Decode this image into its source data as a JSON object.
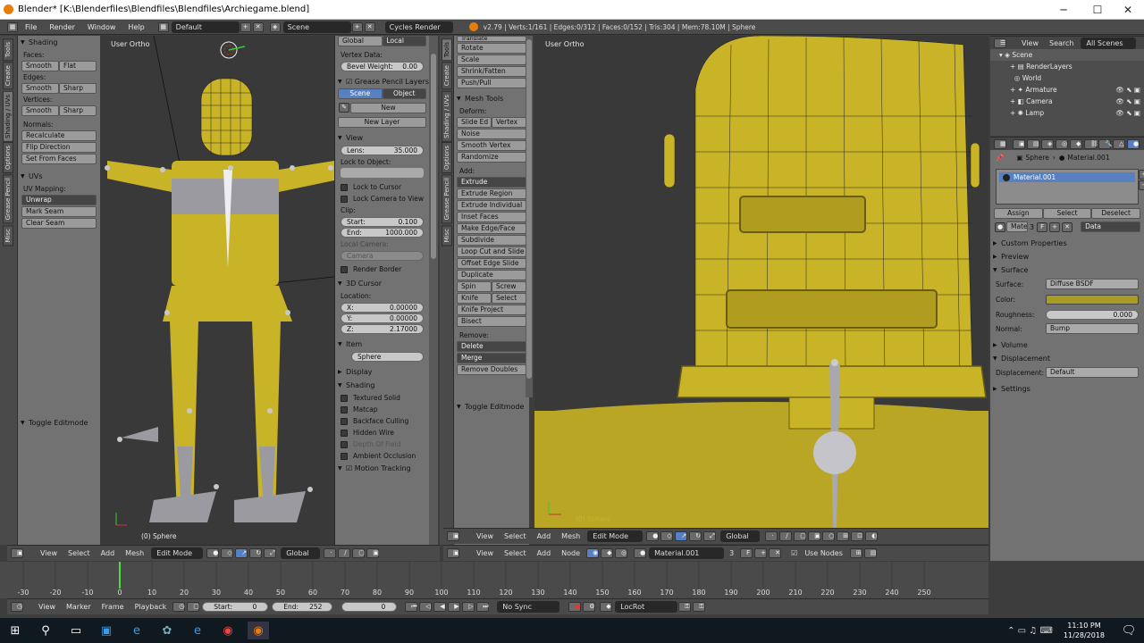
{
  "window": {
    "title": "Blender* [K:\\Blenderfiles\\Blendfiles\\Blendfiles\\Archiegame.blend]",
    "minimize": "─",
    "maximize": "☐",
    "close": "✕"
  },
  "topbar": {
    "menus": [
      "File",
      "Render",
      "Window",
      "Help"
    ],
    "layout": "Default",
    "scene": "Scene",
    "engine": "Cycles Render",
    "stats": "v2.79 | Verts:1/161 | Edges:0/312 | Faces:0/152 | Tris:304 | Mem:78.10M | Sphere"
  },
  "left_tabs": [
    "Tools",
    "Create",
    "Shading / UVs",
    "Options",
    "Grease Pencil",
    "Misc"
  ],
  "left_panel": {
    "shading_header": "Shading",
    "faces_label": "Faces:",
    "smooth": "Smooth",
    "flat": "Flat",
    "edges_label": "Edges:",
    "sharp": "Sharp",
    "vertices_label": "Vertices:",
    "normals_label": "Normals:",
    "recalculate": "Recalculate",
    "flip_direction": "Flip Direction",
    "set_from_faces": "Set From Faces",
    "uvs_header": "UVs",
    "uv_mapping_label": "UV Mapping:",
    "unwrap": "Unwrap",
    "mark_seam": "Mark Seam",
    "clear_seam": "Clear Seam",
    "toggle_editmode": "Toggle Editmode"
  },
  "vp_left": {
    "label": "User Ortho",
    "object": "(0) Sphere",
    "mode": "Edit Mode",
    "orientation": "Global",
    "menus": [
      "View",
      "Select",
      "Add",
      "Mesh"
    ]
  },
  "props_n": {
    "tab_global": "Global",
    "tab_local": "Local",
    "vertex_data": "Vertex Data:",
    "bevel_weight_label": "Bevel Weight:",
    "bevel_weight": "0.00",
    "gp_header": "Grease Pencil Layers",
    "scene": "Scene",
    "object": "Object",
    "new": "New",
    "new_layer": "New Layer",
    "view_header": "View",
    "lens_label": "Lens:",
    "lens": "35.000",
    "lock_to_object": "Lock to Object:",
    "lock_to_cursor": "Lock to Cursor",
    "lock_camera": "Lock Camera to View",
    "clip_label": "Clip:",
    "start_label": "Start:",
    "start": "0.100",
    "end_label": "End:",
    "end": "1000.000",
    "local_camera": "Local Camera:",
    "camera": "Camera",
    "render_border": "Render Border",
    "cursor_header": "3D Cursor",
    "location_label": "Location:",
    "x_label": "X:",
    "x": "0.00000",
    "y_label": "Y:",
    "y": "0.00000",
    "z_label": "Z:",
    "z": "2.17000",
    "item_header": "Item",
    "item_name": "Sphere",
    "display_header": "Display",
    "shading_header": "Shading",
    "textured_solid": "Textured Solid",
    "matcap": "Matcap",
    "backface_culling": "Backface Culling",
    "hidden_wire": "Hidden Wire",
    "depth_of_field": "Depth Of Field",
    "ambient_occlusion": "Ambient Occlusion",
    "motion_tracking": "Motion Tracking"
  },
  "mid_tabs": [
    "Tools",
    "Create",
    "Shading / UVs",
    "Options",
    "Grease Pencil",
    "Misc"
  ],
  "mesh_tools": {
    "translate": "Translate",
    "rotate": "Rotate",
    "scale": "Scale",
    "shrink_fatten": "Shrink/Fatten",
    "push_pull": "Push/Pull",
    "header": "Mesh Tools",
    "deform": "Deform:",
    "slide_edge": "Slide Ed",
    "vertex": "Vertex",
    "noise": "Noise",
    "smooth_vertex": "Smooth Vertex",
    "randomize": "Randomize",
    "add": "Add:",
    "extrude": "Extrude",
    "extrude_region": "Extrude Region",
    "extrude_individual": "Extrude Individual",
    "inset_faces": "Inset Faces",
    "make_edge_face": "Make Edge/Face",
    "subdivide": "Subdivide",
    "loop_cut": "Loop Cut and Slide",
    "offset_edge": "Offset Edge Slide",
    "duplicate": "Duplicate",
    "spin": "Spin",
    "screw": "Screw",
    "knife": "Knife",
    "select": "Select",
    "knife_project": "Knife Project",
    "bisect": "Bisect",
    "remove": "Remove:",
    "delete": "Delete",
    "merge": "Merge",
    "remove_doubles": "Remove Doubles",
    "toggle_editmode": "Toggle Editmode"
  },
  "vp_right": {
    "label": "User Ortho",
    "object": "(0) Sphere",
    "mode": "Edit Mode",
    "orientation": "Global",
    "menus": [
      "View",
      "Select",
      "Add",
      "Mesh"
    ]
  },
  "node_hdr": {
    "menus": [
      "View",
      "Select",
      "Add",
      "Node"
    ],
    "material": "Material.001",
    "users": "3",
    "use_nodes": "Use Nodes"
  },
  "left_node_hdr": {
    "menus": [
      "View",
      "Select",
      "Add",
      "Mesh"
    ],
    "mode": "Edit Mode",
    "orientation": "Global"
  },
  "outliner": {
    "menus": [
      "View",
      "Search"
    ],
    "filter": "All Scenes",
    "items": [
      "Scene",
      "RenderLayers",
      "World",
      "Armature",
      "Camera",
      "Lamp"
    ]
  },
  "properties": {
    "breadcrumb_object": "Sphere",
    "breadcrumb_material": "Material.001",
    "slot": "Material.001",
    "assign": "Assign",
    "select": "Select",
    "deselect": "Deselect",
    "mat_field": "Mater",
    "mat_users": "3",
    "f": "F",
    "data": "Data",
    "custom_props": "Custom Properties",
    "preview": "Preview",
    "surface_header": "Surface",
    "surface_label": "Surface:",
    "surface": "Diffuse BSDF",
    "color_label": "Color:",
    "roughness_label": "Roughness:",
    "roughness": "0.000",
    "normal_label": "Normal:",
    "normal": "Bump",
    "volume": "Volume",
    "displacement_header": "Displacement",
    "displacement_label": "Displacement:",
    "displacement": "Default",
    "settings": "Settings"
  },
  "timeline": {
    "ticks": [
      "-30",
      "-20",
      "-10",
      "0",
      "10",
      "20",
      "30",
      "40",
      "50",
      "60",
      "70",
      "80",
      "90",
      "100",
      "110",
      "120",
      "130",
      "140",
      "150",
      "160",
      "170",
      "180",
      "190",
      "200",
      "210",
      "220",
      "230",
      "240",
      "250"
    ],
    "tick_values": [
      -30,
      -20,
      -10,
      0,
      10,
      20,
      30,
      40,
      50,
      60,
      70,
      80,
      90,
      100,
      110,
      120,
      130,
      140,
      150,
      160,
      170,
      180,
      190,
      200,
      210,
      220,
      230,
      240,
      250
    ],
    "current_frame": 0,
    "menus": [
      "View",
      "Marker",
      "Frame",
      "Playback"
    ],
    "start_label": "Start:",
    "start": "0",
    "end_label": "End:",
    "end": "252",
    "frame": "0",
    "sync": "No Sync",
    "keying": "LocRot"
  },
  "taskbar": {
    "time": "11:10 PM",
    "date": "11/28/2018"
  },
  "colors": {
    "yellow": "#c9b428",
    "accent": "#5680c2"
  }
}
